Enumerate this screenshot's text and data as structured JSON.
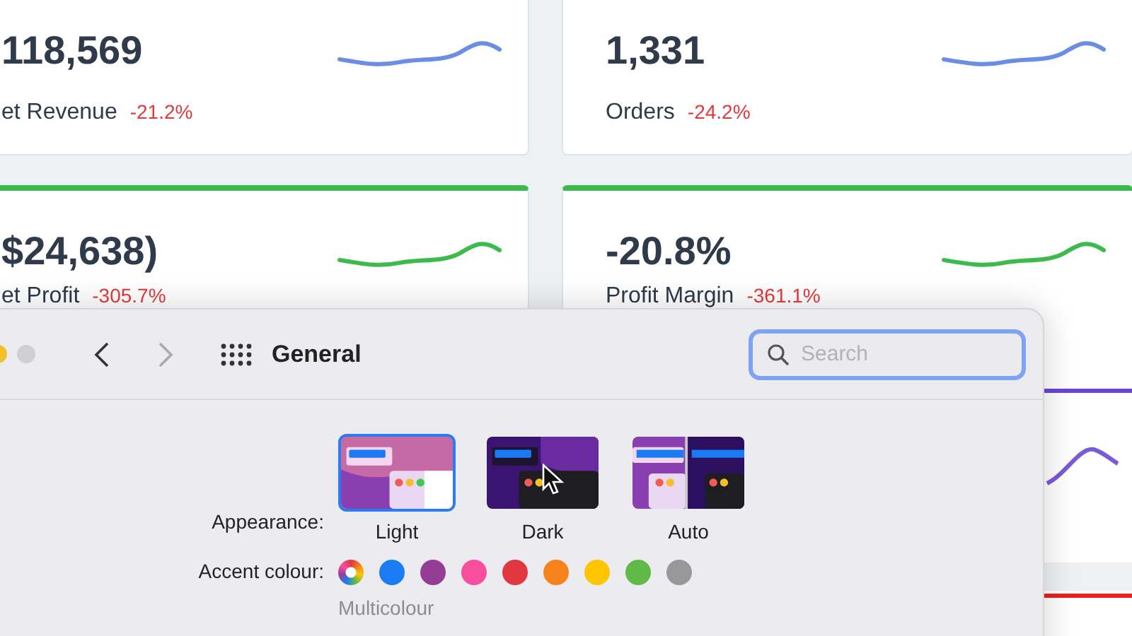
{
  "dashboard": {
    "cards": [
      {
        "value": "118,569",
        "label": "et Revenue",
        "change": "-21.2%",
        "color": "#6b8de3",
        "top_bar": false
      },
      {
        "value": "1,331",
        "label": "Orders",
        "change": "-24.2%",
        "color": "#6b8de3",
        "top_bar": false
      },
      {
        "value": "$24,638)",
        "label": "et Profit",
        "change": "-305.7%",
        "color": "#3dba4e",
        "top_bar": true
      },
      {
        "value": "-20.8%",
        "label": "Profit Margin",
        "change": "-361.1%",
        "color": "#3dba4e",
        "top_bar": true
      }
    ]
  },
  "settings_window": {
    "title": "General",
    "back": {
      "disabled": false
    },
    "forward": {
      "disabled": true
    },
    "search": {
      "placeholder": "Search",
      "focused": true
    },
    "appearance": {
      "label": "Appearance:",
      "options": [
        {
          "label": "Light",
          "kind": "light",
          "selected": true
        },
        {
          "label": "Dark",
          "kind": "dark",
          "selected": false
        },
        {
          "label": "Auto",
          "kind": "auto",
          "selected": false
        }
      ]
    },
    "accent": {
      "label": "Accent colour:",
      "caption": "Multicolour",
      "colours": [
        {
          "kind": "multicolour",
          "selected": true
        },
        {
          "kind": "solid",
          "color": "#1a7cf5",
          "selected": false
        },
        {
          "kind": "solid",
          "color": "#953d96",
          "selected": false
        },
        {
          "kind": "solid",
          "color": "#f74f9e",
          "selected": false
        },
        {
          "kind": "solid",
          "color": "#e0383e",
          "selected": false
        },
        {
          "kind": "solid",
          "color": "#f7821b",
          "selected": false
        },
        {
          "kind": "solid",
          "color": "#ffc600",
          "selected": false
        },
        {
          "kind": "solid",
          "color": "#62ba46",
          "selected": false
        },
        {
          "kind": "solid",
          "color": "#989898",
          "selected": false
        }
      ]
    }
  }
}
